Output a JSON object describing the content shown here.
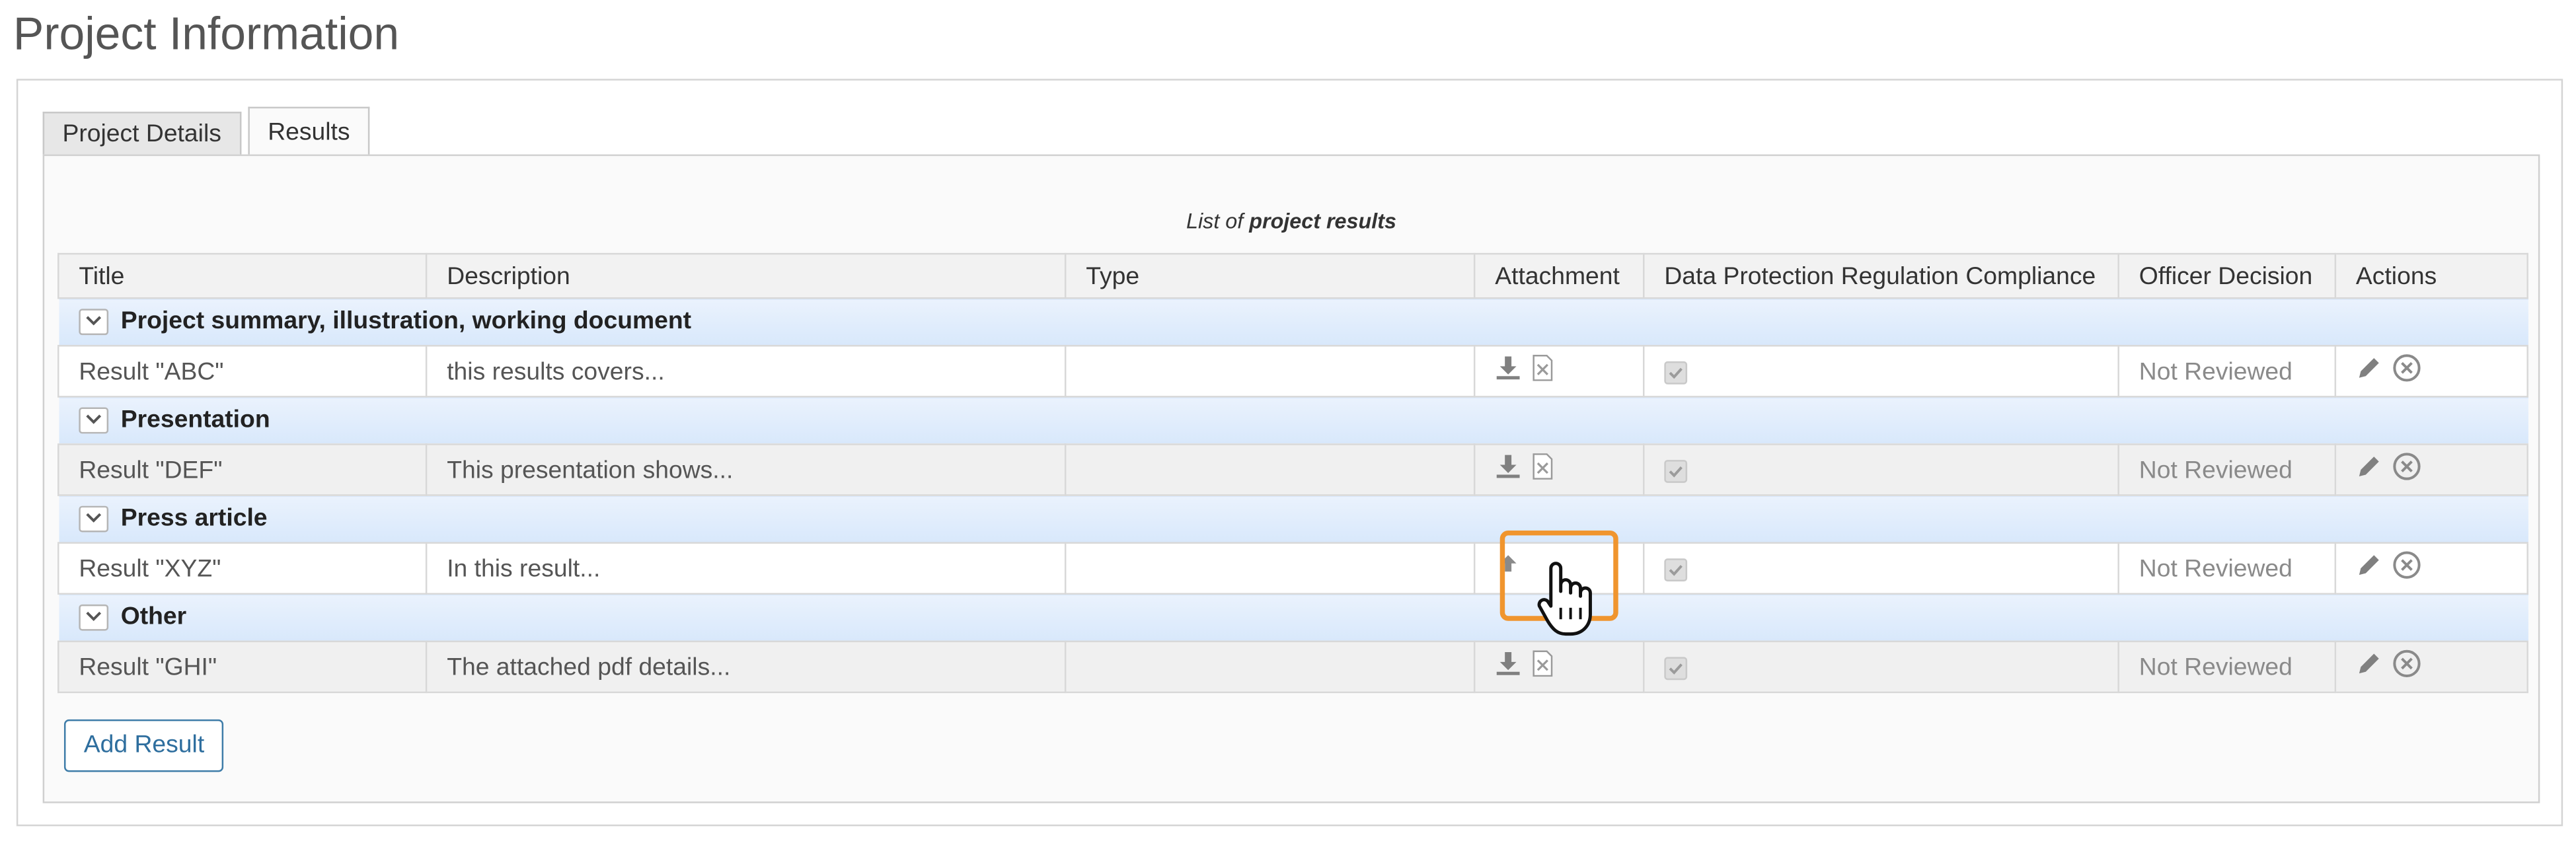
{
  "page": {
    "title": "Project Information"
  },
  "tabs": [
    {
      "label": "Project Details",
      "active": false
    },
    {
      "label": "Results",
      "active": true
    }
  ],
  "table": {
    "caption_prefix": "List of",
    "caption_emphasis": "project results",
    "columns": [
      "Title",
      "Description",
      "Type",
      "Attachment",
      "Data Protection Regulation Compliance",
      "Officer Decision",
      "Actions"
    ],
    "groups": [
      {
        "name": "Project summary, illustration, working document",
        "rows": [
          {
            "title": "Result \"ABC\"",
            "description": "this results covers...",
            "type": "",
            "compliance": true,
            "decision": "Not Reviewed"
          }
        ]
      },
      {
        "name": "Presentation",
        "rows": [
          {
            "title": "Result \"DEF\"",
            "description": "This presentation shows...",
            "type": "",
            "compliance": true,
            "decision": "Not Reviewed"
          }
        ]
      },
      {
        "name": "Press article",
        "rows": [
          {
            "title": "Result \"XYZ\"",
            "description": "In this result...",
            "type": "",
            "compliance": true,
            "decision": "Not Reviewed"
          }
        ]
      },
      {
        "name": "Other",
        "rows": [
          {
            "title": "Result \"GHI\"",
            "description": "The attached pdf details...",
            "type": "",
            "compliance": true,
            "decision": "Not Reviewed"
          }
        ]
      }
    ]
  },
  "icons": {
    "attachment": [
      "download-icon",
      "remove-file-icon"
    ],
    "attachment_empty": "upload-icon",
    "actions": [
      "edit-pencil-icon",
      "delete-circle-icon"
    ],
    "cursor": "hand-pointer-icon"
  },
  "colors": {
    "group_header": "#dce9fb",
    "highlight": "#f0952e",
    "button_text": "#2e6e9e"
  },
  "buttons": {
    "add_result": "Add Result"
  }
}
